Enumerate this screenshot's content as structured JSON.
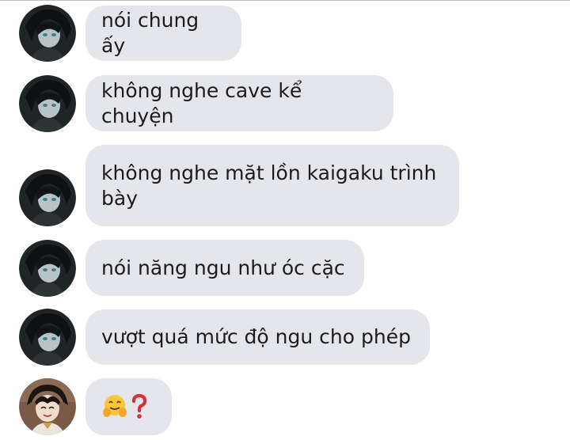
{
  "messages": [
    {
      "sender": "other",
      "text": "nói chung ấy"
    },
    {
      "sender": "other",
      "text": "không nghe cave kể chuyện"
    },
    {
      "sender": "other",
      "text": "không nghe mặt lồn kaigaku trình\nbày"
    },
    {
      "sender": "other",
      "text": "nói năng ngu như óc cặc"
    },
    {
      "sender": "other",
      "text": "vượt quá mức độ ngu cho phép"
    },
    {
      "sender": "other2",
      "emoji": [
        "hugging-face",
        "red-question-mark"
      ]
    }
  ],
  "colors": {
    "bubble": "#e4e6eb",
    "text": "#1c1c1c"
  }
}
